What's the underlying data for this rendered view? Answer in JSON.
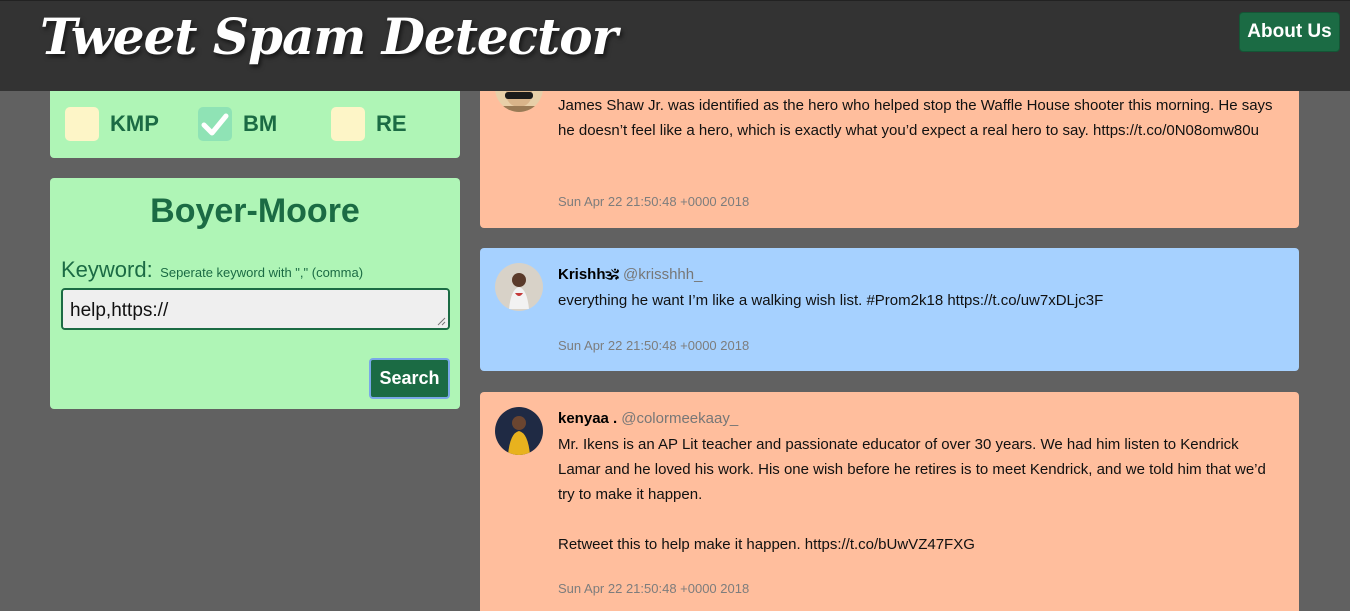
{
  "header": {
    "title": "Tweet Spam Detector",
    "about_label": "About Us"
  },
  "algorithms": [
    {
      "label": "KMP",
      "checked": false
    },
    {
      "label": "BM",
      "checked": true
    },
    {
      "label": "RE",
      "checked": false
    }
  ],
  "search_panel": {
    "title": "Boyer-Moore",
    "keyword_label": "Keyword:",
    "keyword_hint": "Seperate keyword with \",\" (comma)",
    "keyword_value": "help,https://",
    "search_label": "Search"
  },
  "tweets": [
    {
      "name": "",
      "handle": "",
      "text": "James Shaw Jr. was identified as the hero who helped stop the Waffle House shooter this morning. He says he doesn’t feel like a hero, which is exactly what you’d expect a real hero to say. https://t.co/0N08omw80u",
      "date": "Sun Apr 22 21:50:48 +0000 2018",
      "spam": true
    },
    {
      "name": "Krishh🕉",
      "handle": "@krisshhh_",
      "text": "everything he want I’m like a walking wish list. #Prom2k18 https://t.co/uw7xDLjc3F",
      "date": "Sun Apr 22 21:50:48 +0000 2018",
      "spam": false
    },
    {
      "name": "kenyaa .",
      "handle": "@colormeekaay_",
      "text": "Mr. Ikens is an AP Lit teacher and passionate educator of over 30 years. We had him listen to Kendrick Lamar and he loved his work. His one wish before he retires is to meet Kendrick, and we told him that we’d try to make it happen.\n\nRetweet this to help make it happen. https://t.co/bUwVZ47FXG",
      "date": "Sun Apr 22 21:50:48 +0000 2018",
      "spam": true
    }
  ],
  "colors": {
    "page_bg": "#616161",
    "header_bg": "#333333",
    "accent_green": "#1b6b44",
    "panel_green": "#aff5b6",
    "spam_bg": "#ffbe9d",
    "ham_bg": "#a6d1ff"
  }
}
